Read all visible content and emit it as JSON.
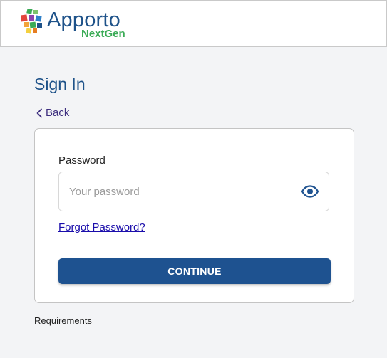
{
  "header": {
    "brand_name": "Apporto",
    "brand_sub": "NextGen",
    "logo_icon": "apporto-logo-icon"
  },
  "page": {
    "title": "Sign In",
    "back_label": "Back"
  },
  "form": {
    "password_label": "Password",
    "password_placeholder": "Your password",
    "password_value": "",
    "toggle_icon": "eye-icon",
    "forgot_label": "Forgot Password?",
    "continue_label": "CONTINUE"
  },
  "footer": {
    "requirements_label": "Requirements"
  },
  "colors": {
    "primary": "#1e5290",
    "brand_blue": "#1e5289",
    "brand_green": "#3bab56",
    "link": "#1a0dab",
    "back_link": "#3e2f7f",
    "background": "#f3f4f6"
  }
}
